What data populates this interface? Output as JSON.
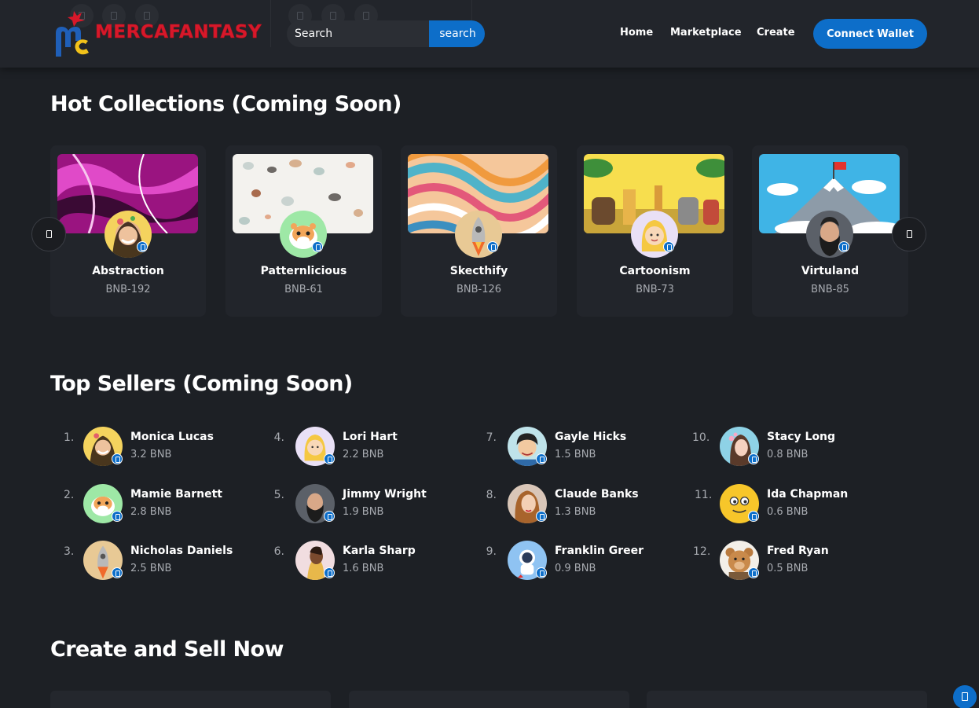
{
  "brand": {
    "name": "MERCAFANTASY",
    "logo_icon": "mc-logo-icon"
  },
  "header": {
    "search": {
      "placeholder": "Search",
      "button_label": "search"
    },
    "nav": [
      {
        "label": "Home"
      },
      {
        "label": "Marketplace"
      },
      {
        "label": "Create"
      }
    ],
    "connect_label": "Connect Wallet"
  },
  "hot_collections": {
    "title": "Hot Collections (Coming Soon)",
    "items": [
      {
        "name": "Abstraction",
        "code": "BNB-192"
      },
      {
        "name": "Patternlicious",
        "code": "BNB-61"
      },
      {
        "name": "Skecthify",
        "code": "BNB-126"
      },
      {
        "name": "Cartoonism",
        "code": "BNB-73"
      },
      {
        "name": "Virtuland",
        "code": "BNB-85"
      }
    ]
  },
  "top_sellers": {
    "title": "Top Sellers (Coming Soon)",
    "items": [
      {
        "rank": "1.",
        "name": "Monica Lucas",
        "value": "3.2 BNB"
      },
      {
        "rank": "2.",
        "name": "Mamie Barnett",
        "value": "2.8 BNB"
      },
      {
        "rank": "3.",
        "name": "Nicholas Daniels",
        "value": "2.5 BNB"
      },
      {
        "rank": "4.",
        "name": "Lori Hart",
        "value": "2.2 BNB"
      },
      {
        "rank": "5.",
        "name": "Jimmy Wright",
        "value": "1.9 BNB"
      },
      {
        "rank": "6.",
        "name": "Karla Sharp",
        "value": "1.6 BNB"
      },
      {
        "rank": "7.",
        "name": "Gayle Hicks",
        "value": "1.5 BNB"
      },
      {
        "rank": "8.",
        "name": "Claude Banks",
        "value": "1.3 BNB"
      },
      {
        "rank": "9.",
        "name": "Franklin Greer",
        "value": "0.9 BNB"
      },
      {
        "rank": "10.",
        "name": "Stacy Long",
        "value": "0.8 BNB"
      },
      {
        "rank": "11.",
        "name": "Ida Chapman",
        "value": "0.6 BNB"
      },
      {
        "rank": "12.",
        "name": "Fred Ryan",
        "value": "0.5 BNB"
      }
    ]
  },
  "create_sell": {
    "title": "Create and Sell Now"
  },
  "colors": {
    "accent": "#0d6ec9",
    "brand_red": "#d7182a",
    "background": "#1d2025",
    "card": "#22252b"
  }
}
